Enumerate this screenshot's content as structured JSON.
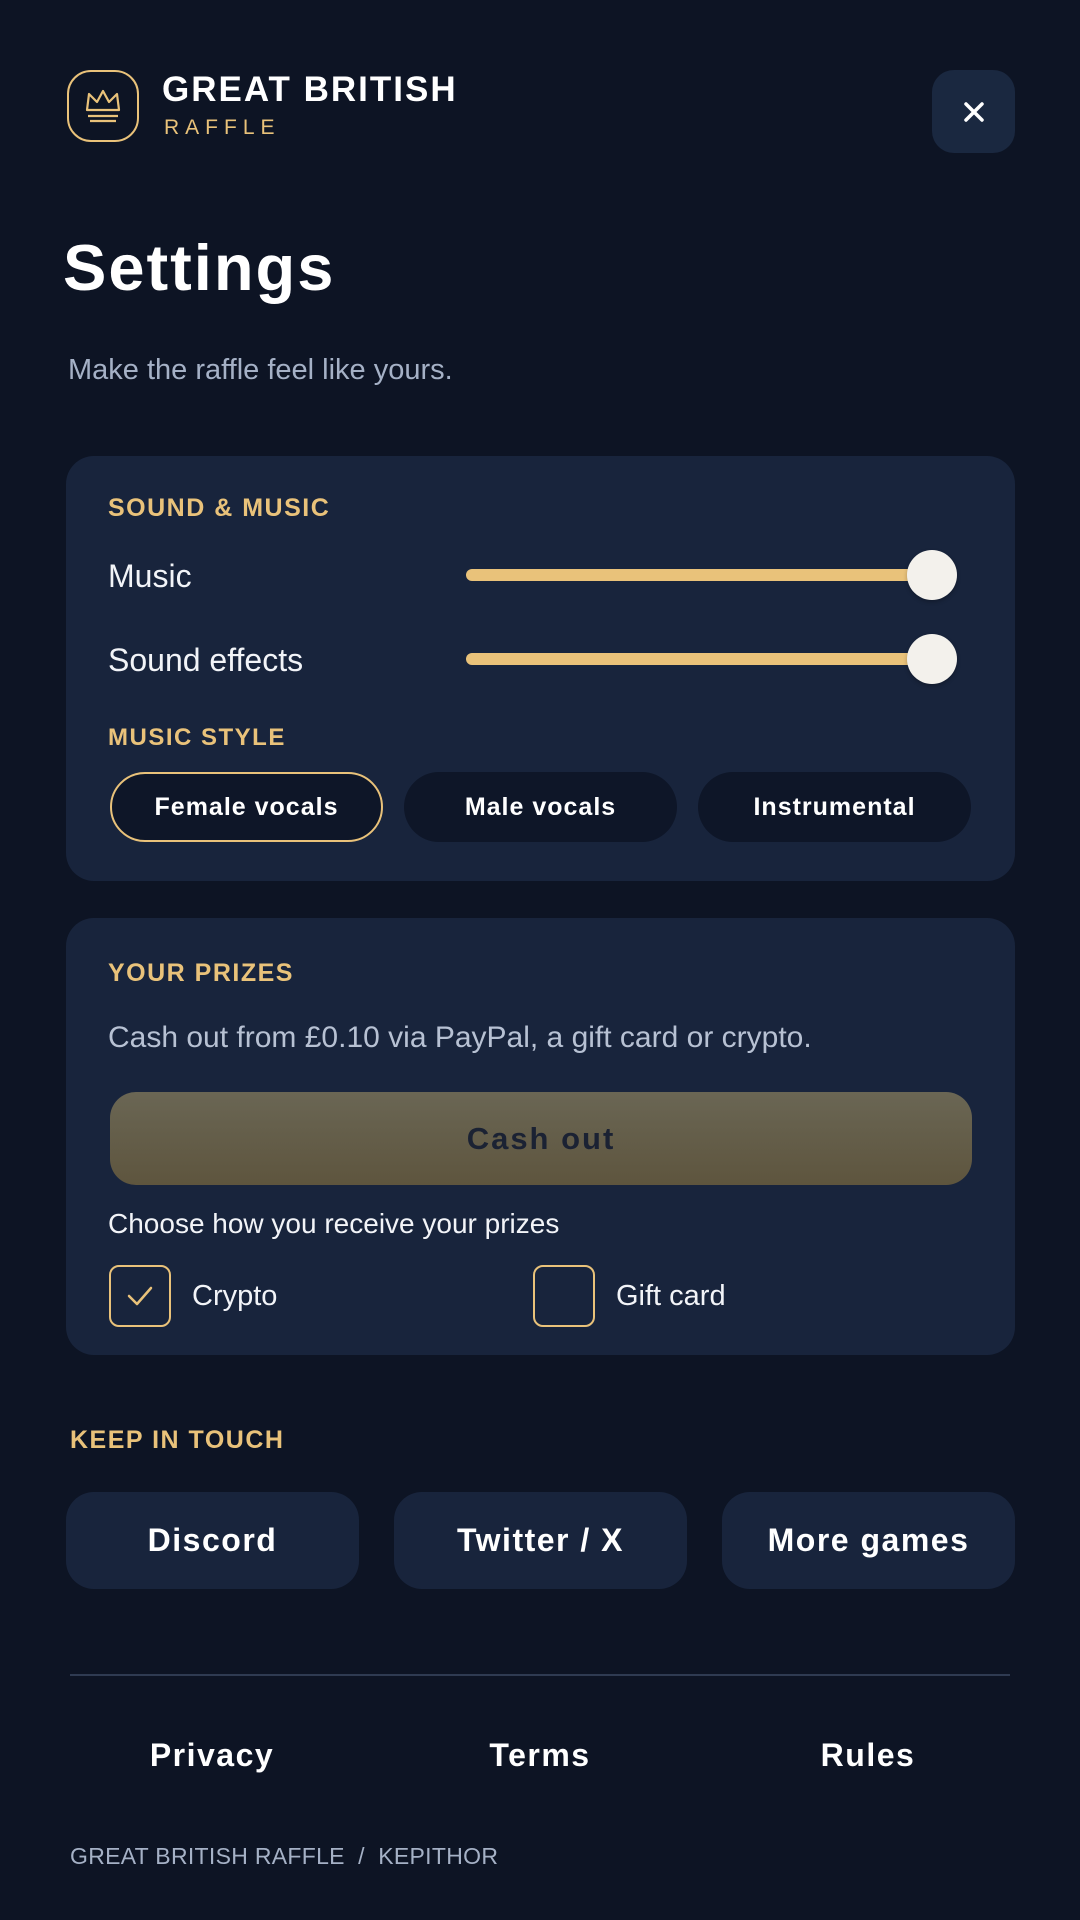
{
  "colors": {
    "background": "#0d1424",
    "card": "#18243c",
    "accent_gold": "#e9c27a",
    "muted_text": "#a5b1c6"
  },
  "header": {
    "logo_icon": "crown-icon",
    "brand_title": "GREAT BRITISH",
    "brand_subtitle": "RAFFLE",
    "close_icon": "close-icon"
  },
  "page": {
    "title": "Settings",
    "subtitle": "Make the raffle feel like yours."
  },
  "sound": {
    "section_label": "SOUND & MUSIC",
    "music_label": "Music",
    "music_volume": 1.0,
    "effects_label": "Sound effects",
    "effects_volume": 1.0,
    "style_label": "MUSIC STYLE",
    "styles": [
      {
        "label": "Female vocals",
        "selected": true
      },
      {
        "label": "Male vocals",
        "selected": false
      },
      {
        "label": "Instrumental",
        "selected": false
      }
    ]
  },
  "prizes": {
    "section_label": "YOUR PRIZES",
    "description": "Cash out from £0.10 via PayPal, a gift card or crypto.",
    "cashout_label": "Cash out",
    "choose_label": "Choose how you receive your prizes",
    "options": [
      {
        "label": "Crypto",
        "checked": true
      },
      {
        "label": "Gift card",
        "checked": false
      }
    ]
  },
  "contact": {
    "section_label": "KEEP IN TOUCH",
    "links": [
      "Discord",
      "Twitter / X",
      "More games"
    ]
  },
  "footer": {
    "links": [
      "Privacy",
      "Terms",
      "Rules"
    ],
    "credit": "GREAT BRITISH RAFFLE  /  KEPITHOR"
  }
}
